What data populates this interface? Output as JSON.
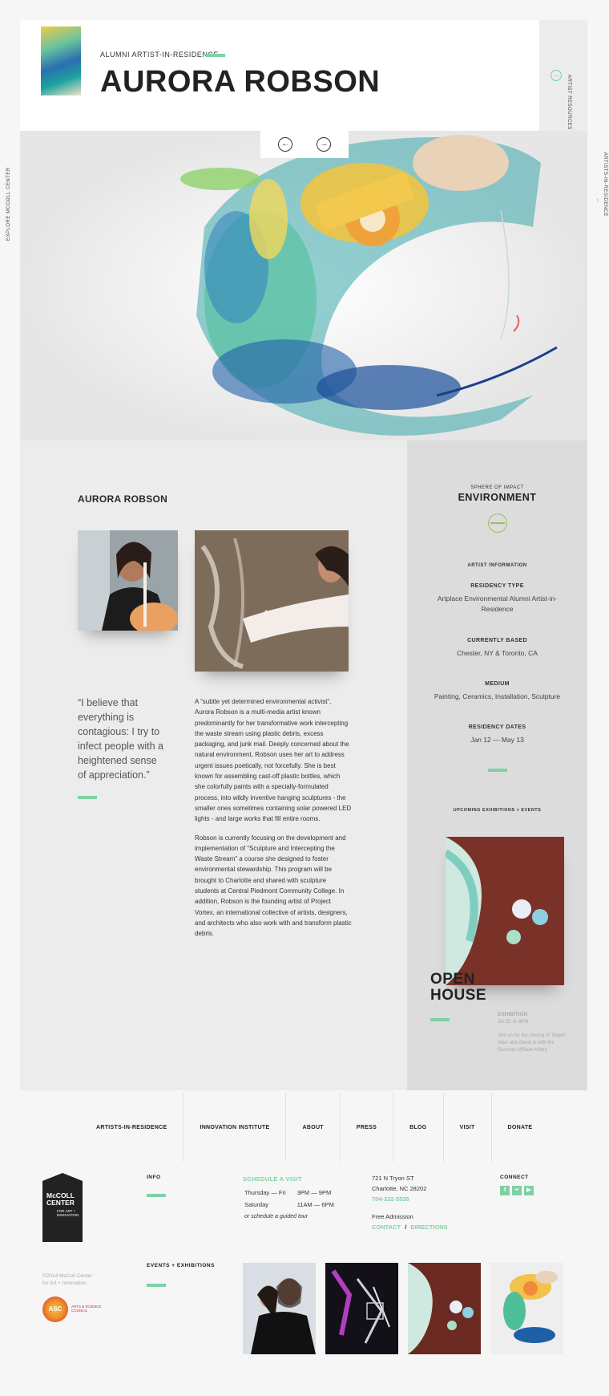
{
  "side": {
    "left": "Explore McColl Center",
    "right": "Artists-in-Residence"
  },
  "header": {
    "kicker": "Alumni Artist-in-Residence",
    "title": "AURORA ROBSON",
    "resources": "Artist Resources"
  },
  "main": {
    "artist_name": "AURORA ROBSON",
    "quote": "“I believe that everything is contagious: I try to infect people with a heightened sense of appreciation.”",
    "bio": [
      "A “subtle yet determined environmental activist”, Aurora Robson is a multi-media artist known predominantly for her transformative work intercepting the waste stream using plastic debris, excess packaging, and junk mail. Deeply concerned about the natural environment, Robson uses her art to address urgent issues poetically, not forcefully. She is best known for assembling cast-off plastic bottles, which she colorfully paints with a specially-formulated process, into wildly inventive hanging sculptures - the smaller ones sometimes containing solar powered LED lights - and large works that fill entire rooms.",
      "Robson is currently focusing on the development and implementation of “Sculpture and Intercepting the Waste Stream” a course she designed to foster environmental stewardship. This program will be brought to Charlotte and shared with sculpture students at Central Piedmont Community College. In addition, Robson is the founding artist of Project Vortex, an international collective of artists, designers, and architects who also work with and transform plastic debris."
    ]
  },
  "sidebar": {
    "sphere_label": "Sphere of Impact",
    "sphere_value": "ENVIRONMENT",
    "info_label": "Artist Information",
    "items": [
      {
        "label": "Residency Type",
        "value": "Artplace Environmental Alumni Artist-in-Residence"
      },
      {
        "label": "Currently Based",
        "value": "Chester, NY & Toronto, CA"
      },
      {
        "label": "Medium",
        "value": "Painting, Ceramics, Installation, Sculpture"
      },
      {
        "label": "Residency Dates",
        "value": "Jan 12 — May 13"
      }
    ],
    "upcoming_label": "Upcoming Exhibitions + Events",
    "event": {
      "title_line1": "OPEN",
      "title_line2": "HOUSE",
      "kind": "Exhibition",
      "date": "Jul 25, 6–9PM",
      "desc": "Join us for the closing of 'Stayin' Alive and check in with the Summer Affiliate Artists"
    }
  },
  "nav": [
    "ARTISTS-IN-RESIDENCE",
    "INNOVATION INSTITUTE",
    "ABOUT",
    "PRESS",
    "BLOG",
    "VISIT",
    "DONATE"
  ],
  "footer": {
    "logo_line1": "McCOLL",
    "logo_line2": "CENTER",
    "logo_line3": "FOR ART +",
    "logo_line4": "INNOVATION",
    "info_label": "INFO",
    "schedule_label": "SCHEDULE A VISIT",
    "hours": [
      {
        "day": "Thursday — Fri",
        "time": "3PM — 9PM"
      },
      {
        "day": "Saturday",
        "time": "11AM — 6PM"
      }
    ],
    "tour_note": "or schedule a guided tour",
    "address1": "721 N Tryon ST",
    "address2": "Charlotte, NC 28202",
    "phone": "704-332-5535",
    "admission": "Free Admission",
    "contact": "CONTACT",
    "separator": "/",
    "directions": "DIRECTIONS",
    "connect_label": "CONNECT",
    "social_f": "f",
    "social_flickr": "••",
    "social_yt": "▶",
    "copyright_line1": "©2014 McColl Center",
    "copyright_line2": "for Art + Innovation",
    "asc_mark": "ASC",
    "asc_line1": "ARTS & SCIENCE",
    "asc_line2": "COUNCIL",
    "events_label": "EVENTS + EXHIBITIONS"
  },
  "icons": {
    "prev": "arrow-left-icon",
    "next": "arrow-right-icon",
    "resources": "arrow-circle-icon",
    "sphere": "environment-icon"
  },
  "colors": {
    "accent": "#7fd1a3",
    "sphere": "#9fbf5e",
    "sidebar_bg": "#dcdcdc",
    "content_bg": "#ececec"
  }
}
